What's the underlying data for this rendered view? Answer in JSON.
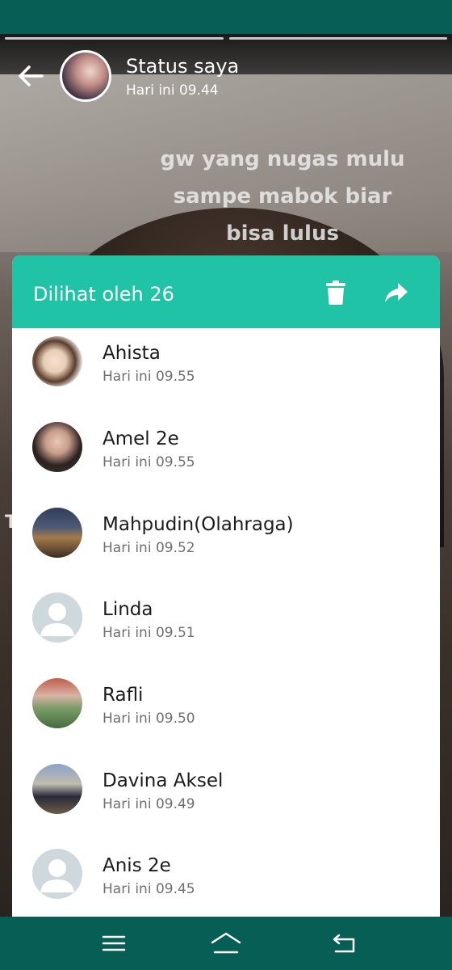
{
  "story": {
    "title": "Status saya",
    "time": "Hari ini 09.44",
    "caption": [
      "gw yang nugas mulu",
      "sampe mabok biar",
      "bisa lulus"
    ],
    "side_text": "T"
  },
  "viewers_sheet": {
    "title": "Dilihat oleh 26",
    "delete_icon": "trash-icon",
    "share_icon": "share-arrow-icon",
    "viewers": [
      {
        "name": "Ahista",
        "time": "Hari ini 09.55"
      },
      {
        "name": "Amel 2e",
        "time": "Hari ini 09.55"
      },
      {
        "name": "Mahpudin(Olahraga)",
        "time": "Hari ini 09.52"
      },
      {
        "name": "Linda",
        "time": "Hari ini 09.51"
      },
      {
        "name": "Rafli",
        "time": "Hari ini 09.50"
      },
      {
        "name": "Davina Aksel",
        "time": "Hari ini 09.49"
      },
      {
        "name": "Anis 2e",
        "time": "Hari ini 09.45"
      }
    ]
  },
  "nav": {
    "menu_icon": "menu-icon",
    "home_icon": "home-icon",
    "back_icon": "back-icon"
  },
  "colors": {
    "header_teal": "#20c3a5",
    "status_green": "#075e54"
  }
}
